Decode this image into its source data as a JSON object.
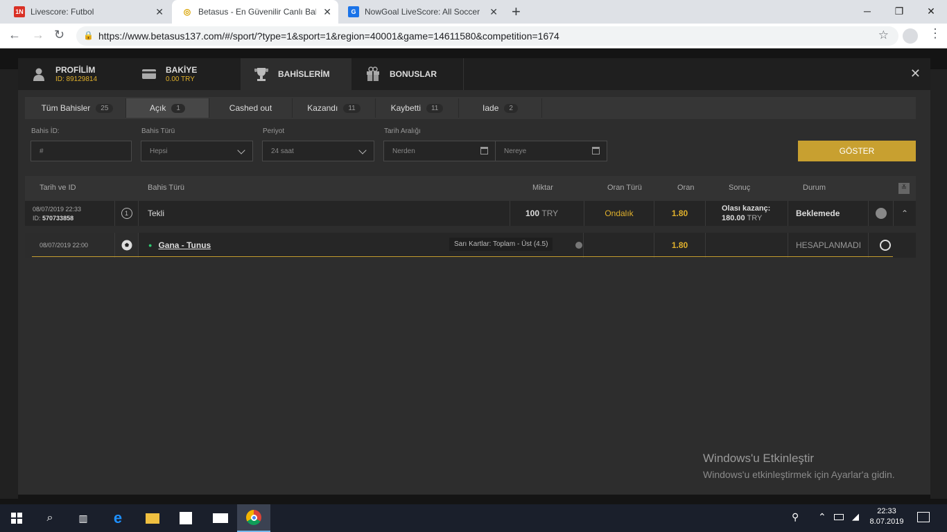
{
  "browser": {
    "tabs": [
      {
        "title": "Livescore: Futbol",
        "favicon": "1N"
      },
      {
        "title": "Betasus - En Güvenilir Canlı Bahis",
        "favicon": "◎"
      },
      {
        "title": "NowGoal LiveScore: All Soccer Sc",
        "favicon": "G"
      }
    ],
    "url": "https://www.betasus137.com/#/sport/?type=1&sport=1&region=40001&game=14611580&competition=1674"
  },
  "modal": {
    "tabs": [
      {
        "label": "PROFİLİM",
        "sub": "ID: 89129814"
      },
      {
        "label": "BAKİYE",
        "sub": "0.00 TRY"
      },
      {
        "label": "BAHİSLERİM"
      },
      {
        "label": "BONUSLAR"
      }
    ],
    "filters": [
      {
        "label": "Tüm Bahisler",
        "count": "25"
      },
      {
        "label": "Açık",
        "count": "1"
      },
      {
        "label": "Cashed out",
        "count": ""
      },
      {
        "label": "Kazandı",
        "count": "11"
      },
      {
        "label": "Kaybetti",
        "count": "11"
      },
      {
        "label": "Iade",
        "count": "2"
      }
    ],
    "form": {
      "bet_id_label": "Bahis İD:",
      "bet_id_placeholder": "#",
      "bet_type_label": "Bahis Türü",
      "bet_type_value": "Hepsi",
      "period_label": "Periyot",
      "period_value": "24 saat",
      "date_range_label": "Tarih Aralığı",
      "from_placeholder": "Nerden",
      "to_placeholder": "Nereye",
      "show_button": "GÖSTER"
    },
    "table": {
      "headers": [
        "Tarih ve ID",
        "Bahis Türü",
        "Miktar",
        "Oran Türü",
        "Oran",
        "Sonuç",
        "Durum"
      ],
      "bet": {
        "date": "08/07/2019 22:33",
        "id_label": "ID:",
        "id": "570733858",
        "index": "1",
        "type": "Tekli",
        "amount": "100",
        "currency": "TRY",
        "odds_type": "Ondalık",
        "odds": "1.80",
        "result_label": "Olası kazanç:",
        "result_value": "180.00",
        "result_currency": "TRY",
        "status": "Beklemede"
      },
      "selection": {
        "date": "08/07/2019 22:00",
        "match": "Gana - Tunus",
        "market": "Sarı Kartlar: Toplam - Üst (4.5)",
        "odds": "1.80",
        "status": "HESAPLANMADI"
      }
    }
  },
  "watermark": {
    "title": "Windows'u Etkinleştir",
    "subtitle": "Windows'u etkinleştirmek için Ayarlar'a gidin."
  },
  "taskbar": {
    "time": "22:33",
    "date": "8.07.2019"
  },
  "colors": {
    "accent": "#e1b12c",
    "button": "#c8a030",
    "modal_bg": "#2d2d2d"
  }
}
